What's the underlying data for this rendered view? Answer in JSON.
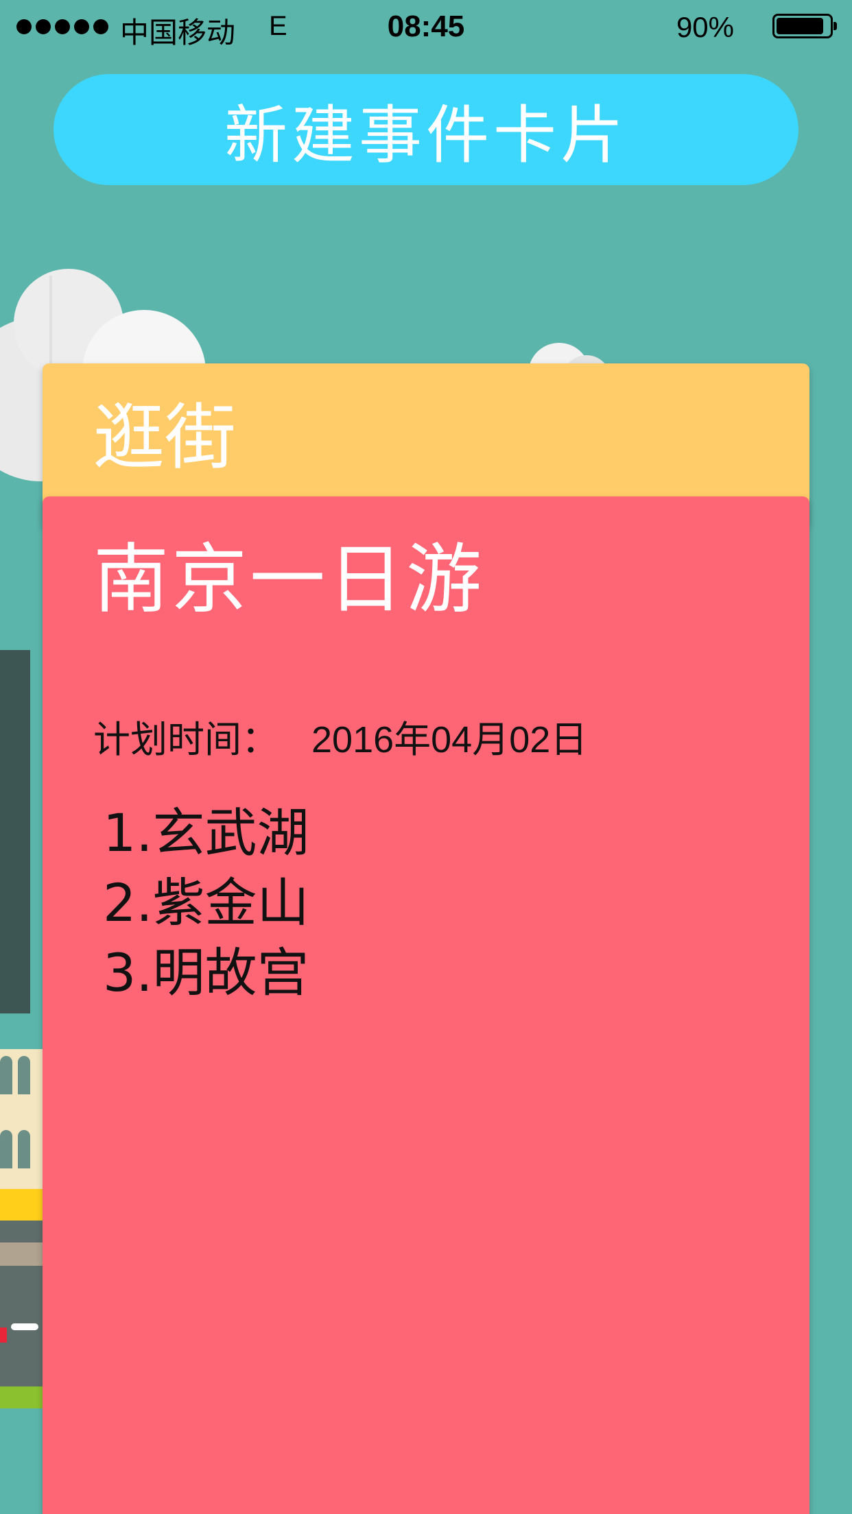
{
  "status_bar": {
    "carrier": "中国移动",
    "network": "E",
    "time": "08:45",
    "battery_percent": "90%",
    "battery_level": 0.9
  },
  "header": {
    "new_card_label": "新建事件卡片"
  },
  "cards": {
    "back": {
      "title": "逛街",
      "color": "#ffcc69"
    },
    "front": {
      "title": "南京一日游",
      "color": "#ff6675",
      "plan_label": "计划时间：",
      "plan_date": "2016年04月02日",
      "items": [
        "1.玄武湖",
        "2.紫金山",
        "3.明故宫"
      ]
    }
  },
  "colors": {
    "background": "#5cb5ab",
    "button": "#3dd6fd"
  }
}
